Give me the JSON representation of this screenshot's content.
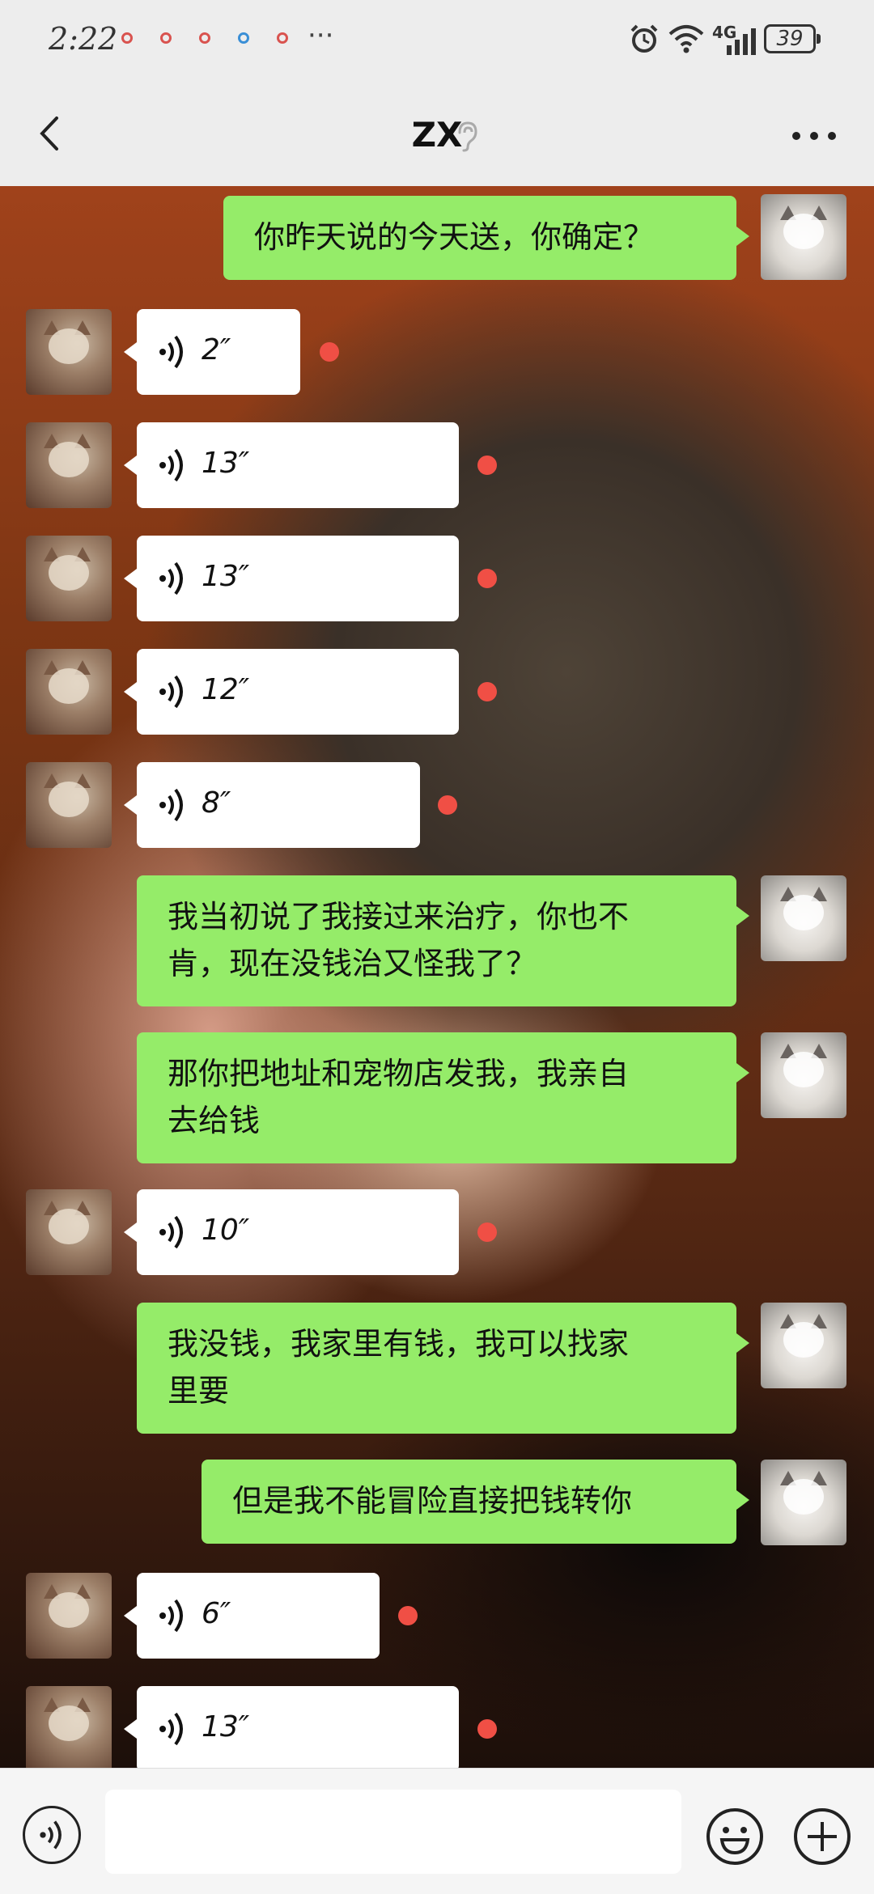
{
  "status_bar": {
    "time": "2:22",
    "network": "4G",
    "battery": "39",
    "more_indicator": "···"
  },
  "header": {
    "title": "ZX",
    "back_icon": "chevron-left-icon",
    "ear_icon": "ear-icon",
    "more_icon": "more-horizontal-icon"
  },
  "messages": [
    {
      "side": "me",
      "type": "text",
      "text": "你昨天说的今天送，你确定？"
    },
    {
      "side": "them",
      "type": "voice",
      "duration": "2″",
      "unread": true
    },
    {
      "side": "them",
      "type": "voice",
      "duration": "13″",
      "unread": true
    },
    {
      "side": "them",
      "type": "voice",
      "duration": "13″",
      "unread": true
    },
    {
      "side": "them",
      "type": "voice",
      "duration": "12″",
      "unread": true
    },
    {
      "side": "them",
      "type": "voice",
      "duration": "8″",
      "unread": true
    },
    {
      "side": "me",
      "type": "text",
      "text": "我当初说了我接过来治疗，你也不肯，现在没钱治又怪我了？",
      "line1": "我当初说了我接过来治疗，你也不",
      "line2": "肯，现在没钱治又怪我了？"
    },
    {
      "side": "me",
      "type": "text",
      "text": "那你把地址和宠物店发我，我亲自去给钱",
      "line1": "那你把地址和宠物店发我，我亲自",
      "line2": "去给钱"
    },
    {
      "side": "them",
      "type": "voice",
      "duration": "10″",
      "unread": true
    },
    {
      "side": "me",
      "type": "text",
      "text": "我没钱，我家里有钱，我可以找家里要",
      "line1": "我没钱，我家里有钱，我可以找家",
      "line2": "里要"
    },
    {
      "side": "me",
      "type": "text",
      "text": "但是我不能冒险直接把钱转你"
    },
    {
      "side": "them",
      "type": "voice",
      "duration": "6″",
      "unread": true
    },
    {
      "side": "them",
      "type": "voice",
      "duration": "13″",
      "unread": true
    }
  ],
  "input_bar": {
    "voice_icon": "voice-mode-icon",
    "placeholder": "",
    "emoji_icon": "emoji-icon",
    "plus_icon": "plus-icon"
  },
  "colors": {
    "my_bubble": "#95ec69",
    "their_bubble": "#ffffff",
    "unread_dot": "#f04f45",
    "bar_background": "#ededed"
  }
}
